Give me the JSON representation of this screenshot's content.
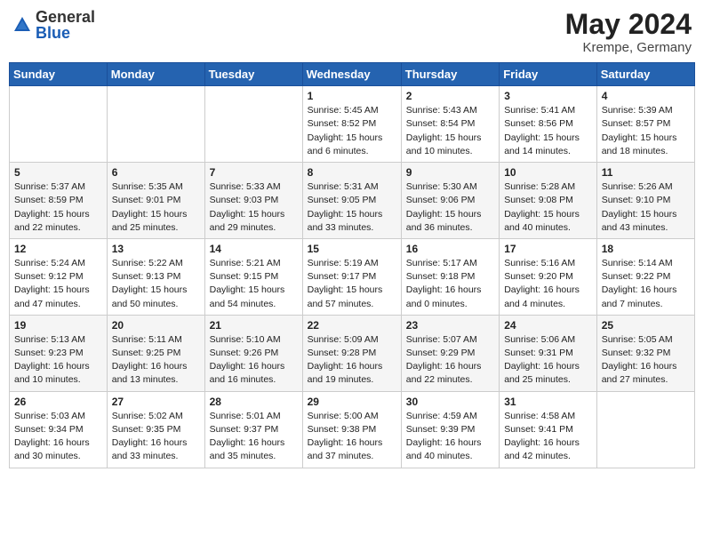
{
  "header": {
    "logo_general": "General",
    "logo_blue": "Blue",
    "month_year": "May 2024",
    "location": "Krempe, Germany"
  },
  "days_of_week": [
    "Sunday",
    "Monday",
    "Tuesday",
    "Wednesday",
    "Thursday",
    "Friday",
    "Saturday"
  ],
  "weeks": [
    [
      {
        "day": "",
        "info": ""
      },
      {
        "day": "",
        "info": ""
      },
      {
        "day": "",
        "info": ""
      },
      {
        "day": "1",
        "info": "Sunrise: 5:45 AM\nSunset: 8:52 PM\nDaylight: 15 hours\nand 6 minutes."
      },
      {
        "day": "2",
        "info": "Sunrise: 5:43 AM\nSunset: 8:54 PM\nDaylight: 15 hours\nand 10 minutes."
      },
      {
        "day": "3",
        "info": "Sunrise: 5:41 AM\nSunset: 8:56 PM\nDaylight: 15 hours\nand 14 minutes."
      },
      {
        "day": "4",
        "info": "Sunrise: 5:39 AM\nSunset: 8:57 PM\nDaylight: 15 hours\nand 18 minutes."
      }
    ],
    [
      {
        "day": "5",
        "info": "Sunrise: 5:37 AM\nSunset: 8:59 PM\nDaylight: 15 hours\nand 22 minutes."
      },
      {
        "day": "6",
        "info": "Sunrise: 5:35 AM\nSunset: 9:01 PM\nDaylight: 15 hours\nand 25 minutes."
      },
      {
        "day": "7",
        "info": "Sunrise: 5:33 AM\nSunset: 9:03 PM\nDaylight: 15 hours\nand 29 minutes."
      },
      {
        "day": "8",
        "info": "Sunrise: 5:31 AM\nSunset: 9:05 PM\nDaylight: 15 hours\nand 33 minutes."
      },
      {
        "day": "9",
        "info": "Sunrise: 5:30 AM\nSunset: 9:06 PM\nDaylight: 15 hours\nand 36 minutes."
      },
      {
        "day": "10",
        "info": "Sunrise: 5:28 AM\nSunset: 9:08 PM\nDaylight: 15 hours\nand 40 minutes."
      },
      {
        "day": "11",
        "info": "Sunrise: 5:26 AM\nSunset: 9:10 PM\nDaylight: 15 hours\nand 43 minutes."
      }
    ],
    [
      {
        "day": "12",
        "info": "Sunrise: 5:24 AM\nSunset: 9:12 PM\nDaylight: 15 hours\nand 47 minutes."
      },
      {
        "day": "13",
        "info": "Sunrise: 5:22 AM\nSunset: 9:13 PM\nDaylight: 15 hours\nand 50 minutes."
      },
      {
        "day": "14",
        "info": "Sunrise: 5:21 AM\nSunset: 9:15 PM\nDaylight: 15 hours\nand 54 minutes."
      },
      {
        "day": "15",
        "info": "Sunrise: 5:19 AM\nSunset: 9:17 PM\nDaylight: 15 hours\nand 57 minutes."
      },
      {
        "day": "16",
        "info": "Sunrise: 5:17 AM\nSunset: 9:18 PM\nDaylight: 16 hours\nand 0 minutes."
      },
      {
        "day": "17",
        "info": "Sunrise: 5:16 AM\nSunset: 9:20 PM\nDaylight: 16 hours\nand 4 minutes."
      },
      {
        "day": "18",
        "info": "Sunrise: 5:14 AM\nSunset: 9:22 PM\nDaylight: 16 hours\nand 7 minutes."
      }
    ],
    [
      {
        "day": "19",
        "info": "Sunrise: 5:13 AM\nSunset: 9:23 PM\nDaylight: 16 hours\nand 10 minutes."
      },
      {
        "day": "20",
        "info": "Sunrise: 5:11 AM\nSunset: 9:25 PM\nDaylight: 16 hours\nand 13 minutes."
      },
      {
        "day": "21",
        "info": "Sunrise: 5:10 AM\nSunset: 9:26 PM\nDaylight: 16 hours\nand 16 minutes."
      },
      {
        "day": "22",
        "info": "Sunrise: 5:09 AM\nSunset: 9:28 PM\nDaylight: 16 hours\nand 19 minutes."
      },
      {
        "day": "23",
        "info": "Sunrise: 5:07 AM\nSunset: 9:29 PM\nDaylight: 16 hours\nand 22 minutes."
      },
      {
        "day": "24",
        "info": "Sunrise: 5:06 AM\nSunset: 9:31 PM\nDaylight: 16 hours\nand 25 minutes."
      },
      {
        "day": "25",
        "info": "Sunrise: 5:05 AM\nSunset: 9:32 PM\nDaylight: 16 hours\nand 27 minutes."
      }
    ],
    [
      {
        "day": "26",
        "info": "Sunrise: 5:03 AM\nSunset: 9:34 PM\nDaylight: 16 hours\nand 30 minutes."
      },
      {
        "day": "27",
        "info": "Sunrise: 5:02 AM\nSunset: 9:35 PM\nDaylight: 16 hours\nand 33 minutes."
      },
      {
        "day": "28",
        "info": "Sunrise: 5:01 AM\nSunset: 9:37 PM\nDaylight: 16 hours\nand 35 minutes."
      },
      {
        "day": "29",
        "info": "Sunrise: 5:00 AM\nSunset: 9:38 PM\nDaylight: 16 hours\nand 37 minutes."
      },
      {
        "day": "30",
        "info": "Sunrise: 4:59 AM\nSunset: 9:39 PM\nDaylight: 16 hours\nand 40 minutes."
      },
      {
        "day": "31",
        "info": "Sunrise: 4:58 AM\nSunset: 9:41 PM\nDaylight: 16 hours\nand 42 minutes."
      },
      {
        "day": "",
        "info": ""
      }
    ]
  ]
}
